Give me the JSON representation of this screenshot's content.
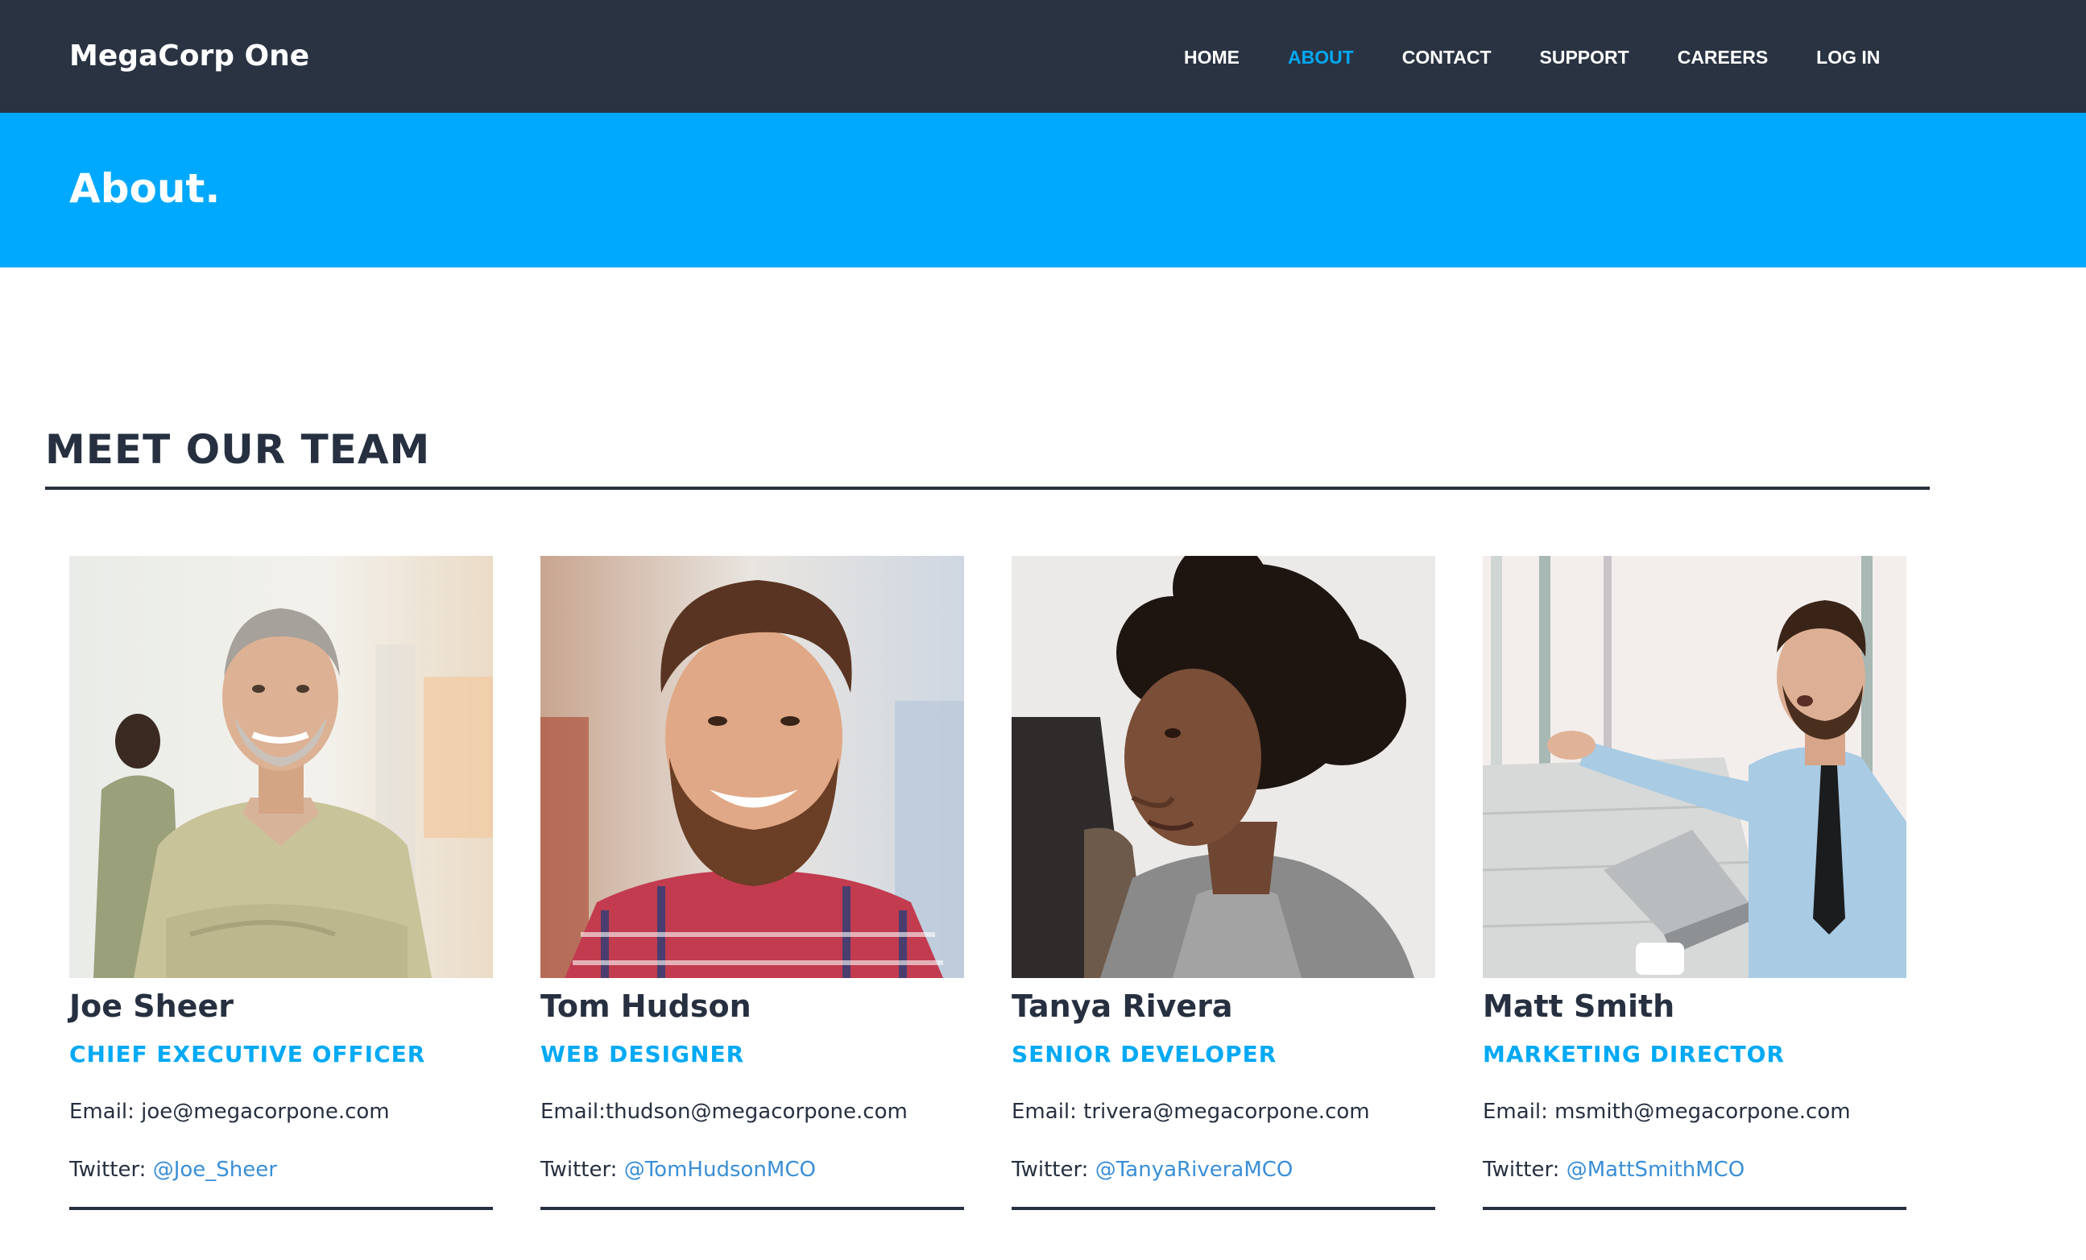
{
  "header": {
    "brand": "MegaCorp One",
    "nav": [
      {
        "label": "HOME",
        "active": false
      },
      {
        "label": "ABOUT",
        "active": true
      },
      {
        "label": "CONTACT",
        "active": false
      },
      {
        "label": "SUPPORT",
        "active": false
      },
      {
        "label": "CAREERS",
        "active": false
      },
      {
        "label": "LOG IN",
        "active": false
      }
    ]
  },
  "banner": {
    "title": "About."
  },
  "team": {
    "heading": "MEET OUR TEAM",
    "members": [
      {
        "name": "Joe Sheer",
        "role": "CHIEF EXECUTIVE OFFICER",
        "email_text": "Email: joe@megacorpone.com",
        "twitter_prefix": "Twitter: ",
        "twitter_handle": "@Joe_Sheer"
      },
      {
        "name": "Tom Hudson",
        "role": "WEB DESIGNER",
        "email_text": "Email:thudson@megacorpone.com",
        "twitter_prefix": "Twitter: ",
        "twitter_handle": "@TomHudsonMCO"
      },
      {
        "name": "Tanya Rivera",
        "role": "SENIOR DEVELOPER",
        "email_text": "Email: trivera@megacorpone.com",
        "twitter_prefix": "Twitter: ",
        "twitter_handle": "@TanyaRiveraMCO"
      },
      {
        "name": "Matt Smith",
        "role": "MARKETING DIRECTOR",
        "email_text": "Email: msmith@megacorpone.com",
        "twitter_prefix": "Twitter: ",
        "twitter_handle": "@MattSmithMCO"
      }
    ]
  },
  "colors": {
    "navbar_bg": "#2a3342",
    "accent": "#00a9f4",
    "banner_bg": "#00a9fd",
    "text_dark": "#263040",
    "link": "#3a8fd6"
  }
}
